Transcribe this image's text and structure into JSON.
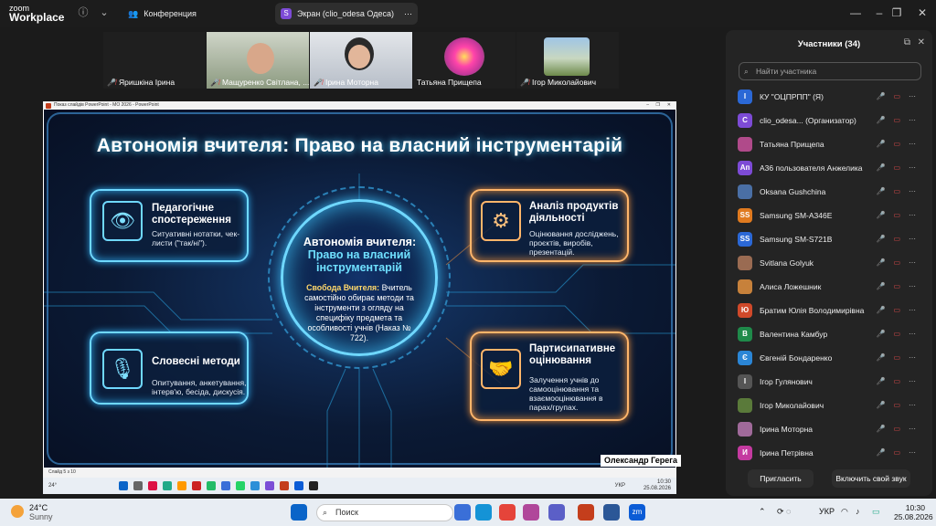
{
  "app": {
    "brand_top": "zoom",
    "brand_bottom": "Workplace"
  },
  "tabs": [
    {
      "label": "Конференция"
    },
    {
      "label": "Экран (clio_odesa Одеса)",
      "badge": "S"
    }
  ],
  "video_tiles": [
    {
      "name": "Яришкіна Ірина"
    },
    {
      "name": "Мащуренко Світлана, ..."
    },
    {
      "name": "Ірина Моторна"
    },
    {
      "name": "Татьяна Прищепа"
    },
    {
      "name": "Ігор Миколайович"
    }
  ],
  "ppt": {
    "window_title": "Показ слайдів PowerPoint  -  МО 2026  -  PowerPoint",
    "status": "Слайд 5 з 10",
    "presenter": "Олександр Герега"
  },
  "slide": {
    "title": "Автономія вчителя: Право на власний інструментарій",
    "panels": [
      {
        "heading": "Педагогічне спостереження",
        "text": "Ситуативні нотатки, чек-листи (\"так/ні\")."
      },
      {
        "heading": "Аналіз продуктів діяльності",
        "text": "Оцінювання досліджень, проєктів, виробів, презентацій."
      },
      {
        "heading": "Словесні методи",
        "text": "Опитування, анкетування, інтерв'ю, бесіда, дискусія."
      },
      {
        "heading": "Партисипативне оцінювання",
        "text": "Залучення учнів до самооцінювання та взаємооцінювання в парах/групах."
      }
    ],
    "center": {
      "head1": "Автономія вчителя:",
      "head2": "Право на власний інструментарій",
      "lead": "Свобода Вчителя:",
      "body": "Вчитель самостійно обирає методи та інструменти з огляду на специфіку предмета та особливості учнів (Наказ № 722)."
    }
  },
  "participants": {
    "title": "Участники (34)",
    "search_placeholder": "Найти участника",
    "list": [
      {
        "initial": "І",
        "name": "КУ \"ОЦПРПП\" (Я)",
        "color": "#2b68d6"
      },
      {
        "initial": "C",
        "name": "clio_odesa... (Организатор)",
        "color": "#7d4bd6"
      },
      {
        "initial": "",
        "name": "Татьяна Прищепа",
        "color": "#b04a8a"
      },
      {
        "initial": "Ап",
        "name": "А36 пользователя Анжелика",
        "color": "#7d4bd6"
      },
      {
        "initial": "",
        "name": "Oksana Gushchina",
        "color": "#4a6fa5"
      },
      {
        "initial": "SS",
        "name": "Samsung SM-A346E",
        "color": "#e07a1f"
      },
      {
        "initial": "SS",
        "name": "Samsung SM-S721B",
        "color": "#2b68d6"
      },
      {
        "initial": "",
        "name": "Svitlana Golyuk",
        "color": "#9a6b52"
      },
      {
        "initial": "",
        "name": "Алиса Ложешник",
        "color": "#c7813b"
      },
      {
        "initial": "Ю",
        "name": "Братим Юлія Володимирівна",
        "color": "#d0492a"
      },
      {
        "initial": "В",
        "name": "Валентина Камбур",
        "color": "#1f8a4a"
      },
      {
        "initial": "Є",
        "name": "Євгеній Бондаренко",
        "color": "#2b86d6"
      },
      {
        "initial": "І",
        "name": "Ігор Гулянович",
        "color": "#555"
      },
      {
        "initial": "",
        "name": "Ігор Миколайович",
        "color": "#5a7a3a"
      },
      {
        "initial": "",
        "name": "Ірина Моторна",
        "color": "#a06a9a"
      },
      {
        "initial": "И",
        "name": "Ірина Петрівна",
        "color": "#c43aa0"
      }
    ],
    "invite_label": "Пригласить",
    "unmute_label": "Включить свой звук"
  },
  "inner_taskbar": {
    "weather": "24°",
    "lang": "УКР",
    "time": "10:30",
    "date": "25.08.2026"
  },
  "taskbar": {
    "weather_temp": "24°C",
    "weather_desc": "Sunny",
    "search_placeholder": "Поиск",
    "lang": "УКР",
    "time": "10:30",
    "date": "25.08.2026"
  }
}
